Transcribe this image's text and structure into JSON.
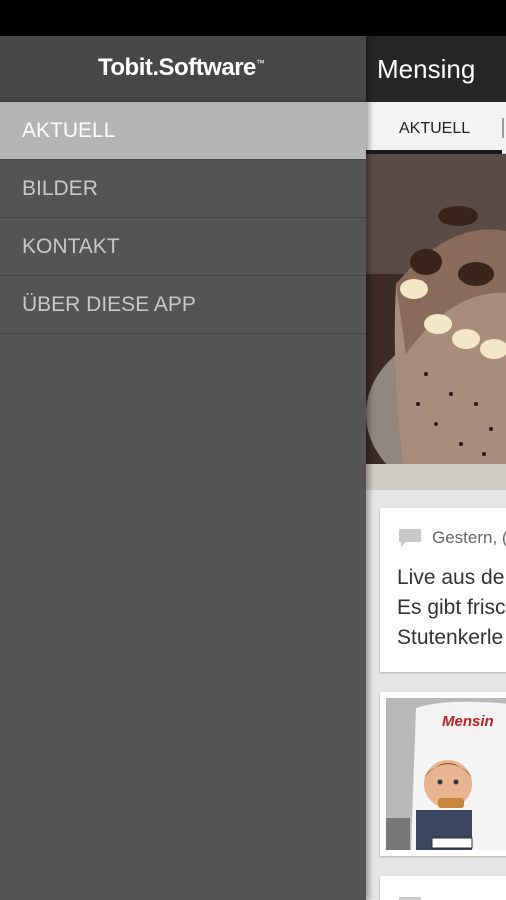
{
  "app": {
    "title": "Mensing",
    "tabs": [
      {
        "label": "AKTUELL"
      }
    ]
  },
  "drawer": {
    "logo": "Tobit.Software",
    "logo_mark": "™",
    "items": [
      {
        "label": "AKTUELL",
        "active": true
      },
      {
        "label": "BILDER",
        "active": false
      },
      {
        "label": "KONTAKT",
        "active": false
      },
      {
        "label": "ÜBER DIESE APP",
        "active": false
      }
    ]
  },
  "feed": {
    "card1": {
      "meta": "Gestern, (",
      "lines": [
        "Live aus de",
        "Es gibt frisc",
        "Stutenkerle"
      ]
    }
  },
  "images": {
    "hero": "chocolate cake",
    "van": "Mensing delivery van with child",
    "van_text": "Mensin"
  },
  "colors": {
    "drawer_bg": "#545454",
    "active_item": "#b5b5b5",
    "app_bar": "#262626"
  }
}
